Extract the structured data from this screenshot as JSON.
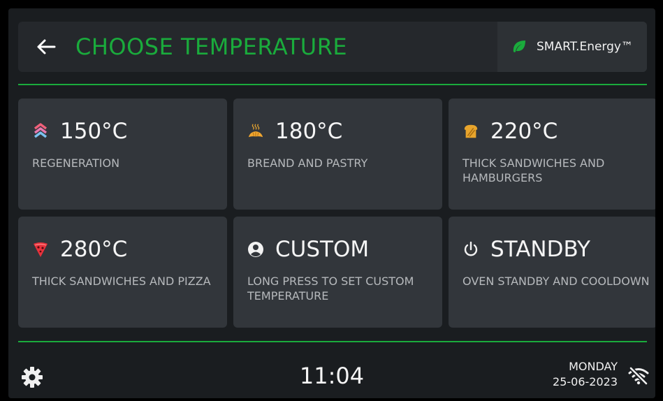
{
  "header": {
    "title": "CHOOSE TEMPERATURE",
    "back_icon": "arrow-left-icon",
    "energy_label": "SMART.Energy™",
    "energy_icon": "leaf-icon"
  },
  "colors": {
    "accent": "#1aab3c",
    "card_bg": "#32363b",
    "screen_bg": "#1a1d20"
  },
  "cards": [
    {
      "title": "150°C",
      "subtitle": "REGENERATION",
      "icon": "regeneration-chevrons-icon"
    },
    {
      "title": "180°C",
      "subtitle": "BREAND AND PASTRY",
      "icon": "croissant-icon"
    },
    {
      "title": "220°C",
      "subtitle": "THICK SANDWICHES AND HAMBURGERS",
      "icon": "toast-icon"
    },
    {
      "title": "280°C",
      "subtitle": "THICK SANDWICHES AND PIZZA",
      "icon": "pizza-icon"
    },
    {
      "title": "CUSTOM",
      "subtitle": "LONG PRESS TO SET CUSTOM TEMPERATURE",
      "icon": "user-circle-icon"
    },
    {
      "title": "STANDBY",
      "subtitle": "OVEN STANDBY AND COOLDOWN",
      "icon": "power-icon"
    }
  ],
  "footer": {
    "settings_icon": "gear-icon",
    "time": "11:04",
    "day": "MONDAY",
    "date": "25-06-2023",
    "wifi_icon": "wifi-off-icon"
  }
}
